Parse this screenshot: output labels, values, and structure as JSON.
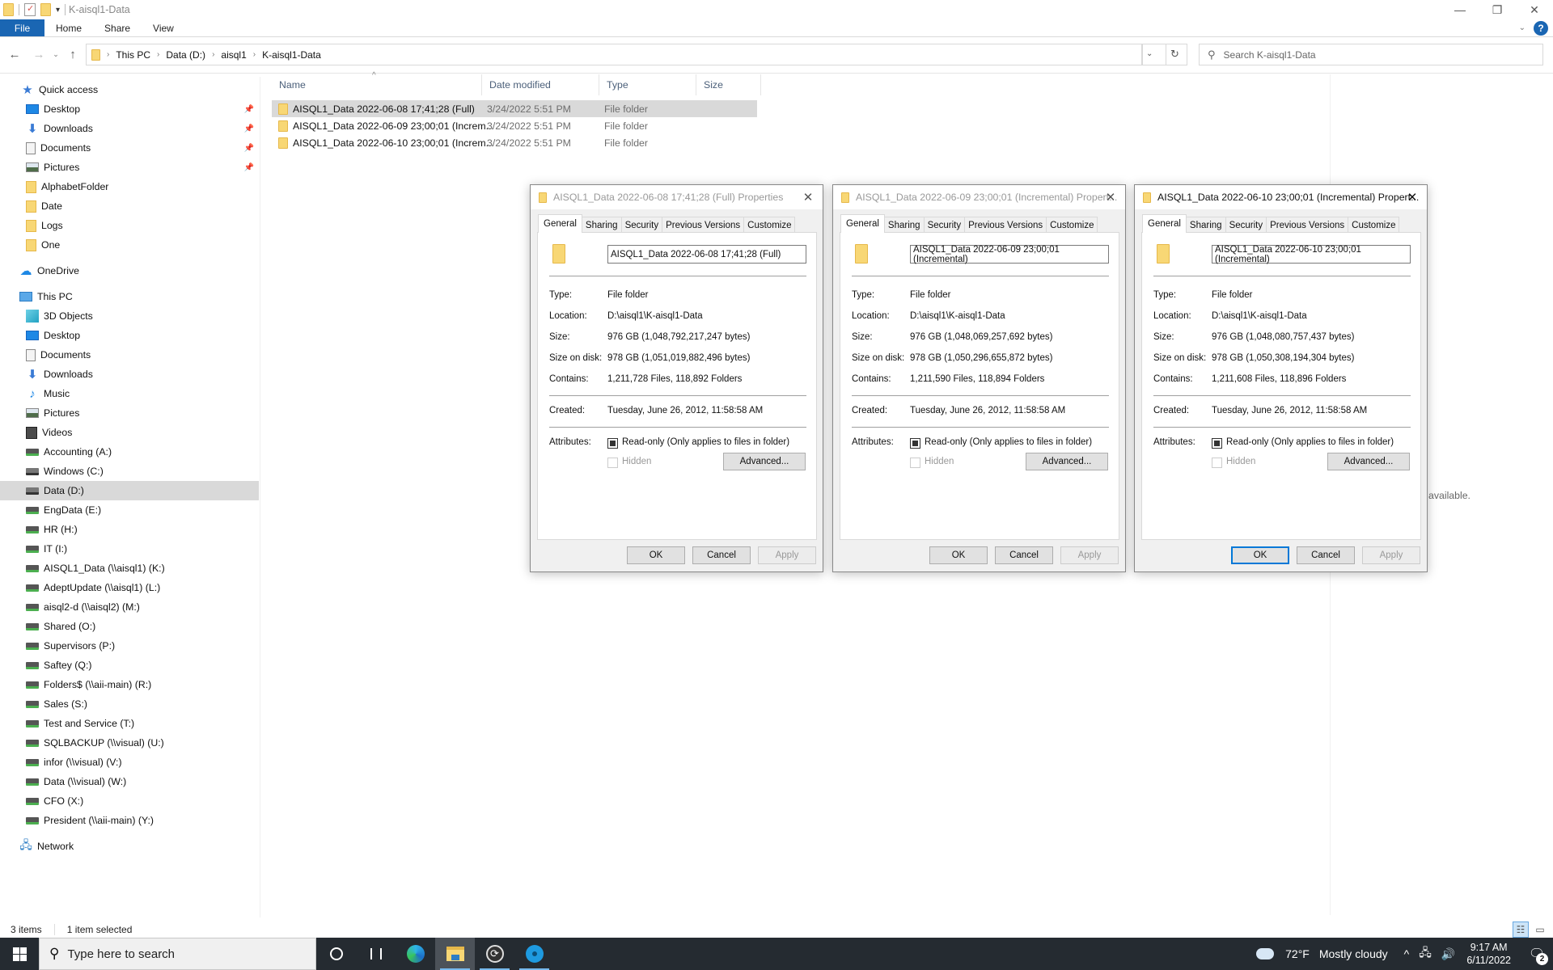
{
  "window": {
    "title": "K-aisql1-Data",
    "controls": {
      "minimize": "—",
      "maximize": "❐",
      "close": "✕"
    }
  },
  "ribbon": {
    "tabs": [
      "File",
      "Home",
      "Share",
      "View"
    ],
    "expand_icon": "chevron-down",
    "help_label": "?"
  },
  "nav": {
    "back": "←",
    "forward": "→",
    "recent": "⌄",
    "up": "↑",
    "breadcrumb": [
      "This PC",
      "Data (D:)",
      "aisql1",
      "K-aisql1-Data"
    ],
    "refresh": "↻",
    "search_placeholder": "Search K-aisql1-Data"
  },
  "sidebar": {
    "quick_access": {
      "label": "Quick access",
      "items": [
        {
          "label": "Desktop",
          "icon": "desktop",
          "pinned": true
        },
        {
          "label": "Downloads",
          "icon": "downloads",
          "pinned": true
        },
        {
          "label": "Documents",
          "icon": "documents",
          "pinned": true
        },
        {
          "label": "Pictures",
          "icon": "pictures",
          "pinned": true
        },
        {
          "label": "AlphabetFolder",
          "icon": "folder",
          "pinned": false
        },
        {
          "label": "Date",
          "icon": "folder",
          "pinned": false
        },
        {
          "label": "Logs",
          "icon": "folder",
          "pinned": false
        },
        {
          "label": "One",
          "icon": "folder",
          "pinned": false
        }
      ]
    },
    "onedrive": {
      "label": "OneDrive"
    },
    "this_pc": {
      "label": "This PC",
      "items": [
        {
          "label": "3D Objects",
          "icon": "3d"
        },
        {
          "label": "Desktop",
          "icon": "desktop"
        },
        {
          "label": "Documents",
          "icon": "documents"
        },
        {
          "label": "Downloads",
          "icon": "downloads"
        },
        {
          "label": "Music",
          "icon": "music"
        },
        {
          "label": "Pictures",
          "icon": "pictures"
        },
        {
          "label": "Videos",
          "icon": "videos"
        },
        {
          "label": "Accounting (A:)",
          "icon": "network-drive"
        },
        {
          "label": "Windows (C:)",
          "icon": "windows-drive"
        },
        {
          "label": "Data (D:)",
          "icon": "local-drive",
          "selected": true
        },
        {
          "label": "EngData (E:)",
          "icon": "network-drive"
        },
        {
          "label": "HR (H:)",
          "icon": "network-drive"
        },
        {
          "label": "IT (I:)",
          "icon": "network-drive"
        },
        {
          "label": "AISQL1_Data (\\\\aisql1) (K:)",
          "icon": "network-drive"
        },
        {
          "label": "AdeptUpdate (\\\\aisql1) (L:)",
          "icon": "network-drive"
        },
        {
          "label": "aisql2-d (\\\\aisql2) (M:)",
          "icon": "network-drive"
        },
        {
          "label": "Shared (O:)",
          "icon": "network-drive"
        },
        {
          "label": "Supervisors (P:)",
          "icon": "network-drive"
        },
        {
          "label": "Saftey (Q:)",
          "icon": "network-drive"
        },
        {
          "label": "Folders$ (\\\\aii-main) (R:)",
          "icon": "network-drive"
        },
        {
          "label": "Sales (S:)",
          "icon": "network-drive"
        },
        {
          "label": "Test and Service (T:)",
          "icon": "network-drive"
        },
        {
          "label": "SQLBACKUP (\\\\visual) (U:)",
          "icon": "network-drive"
        },
        {
          "label": "infor (\\\\visual) (V:)",
          "icon": "network-drive"
        },
        {
          "label": "Data (\\\\visual) (W:)",
          "icon": "network-drive"
        },
        {
          "label": "CFO (X:)",
          "icon": "network-drive"
        },
        {
          "label": "President (\\\\aii-main) (Y:)",
          "icon": "network-drive"
        }
      ]
    },
    "network": {
      "label": "Network"
    }
  },
  "filelist": {
    "columns": [
      "Name",
      "Date modified",
      "Type",
      "Size"
    ],
    "rows": [
      {
        "name": "AISQL1_Data 2022-06-08 17;41;28 (Full)",
        "date": "3/24/2022 5:51 PM",
        "type": "File folder",
        "size": "",
        "selected": true
      },
      {
        "name": "AISQL1_Data 2022-06-09 23;00;01 (Increm...",
        "date": "3/24/2022 5:51 PM",
        "type": "File folder",
        "size": "",
        "selected": false
      },
      {
        "name": "AISQL1_Data 2022-06-10 23;00;01 (Increm...",
        "date": "3/24/2022 5:51 PM",
        "type": "File folder",
        "size": "",
        "selected": false
      }
    ]
  },
  "preview": {
    "message": "view available."
  },
  "status": {
    "items": "3 items",
    "selected": "1 item selected"
  },
  "dialog_common": {
    "tabs": [
      "General",
      "Sharing",
      "Security",
      "Previous Versions",
      "Customize"
    ],
    "labels": {
      "type": "Type:",
      "location": "Location:",
      "size": "Size:",
      "size_on_disk": "Size on disk:",
      "contains": "Contains:",
      "created": "Created:",
      "attributes": "Attributes:"
    },
    "readonly_label": "Read-only (Only applies to files in folder)",
    "hidden_label": "Hidden",
    "advanced_label": "Advanced...",
    "ok_label": "OK",
    "cancel_label": "Cancel",
    "apply_label": "Apply",
    "close_icon": "✕"
  },
  "dialogs": [
    {
      "title": "AISQL1_Data 2022-06-08 17;41;28 (Full) Properties",
      "name": "AISQL1_Data 2022-06-08 17;41;28 (Full)",
      "type": "File folder",
      "location": "D:\\aisql1\\K-aisql1-Data",
      "size": "976 GB (1,048,792,217,247 bytes)",
      "size_on_disk": "978 GB (1,051,019,882,496 bytes)",
      "contains": "1,211,728 Files, 118,892 Folders",
      "created": "Tuesday, June 26, 2012, 11:58:58 AM",
      "readonly": "indeterminate",
      "hidden": false,
      "active": false
    },
    {
      "title": "AISQL1_Data 2022-06-09 23;00;01 (Incremental) Propert...",
      "name": "AISQL1_Data 2022-06-09 23;00;01 (Incremental)",
      "type": "File folder",
      "location": "D:\\aisql1\\K-aisql1-Data",
      "size": "976 GB (1,048,069,257,692 bytes)",
      "size_on_disk": "978 GB (1,050,296,655,872 bytes)",
      "contains": "1,211,590 Files, 118,894 Folders",
      "created": "Tuesday, June 26, 2012, 11:58:58 AM",
      "readonly": "indeterminate",
      "hidden": false,
      "active": false
    },
    {
      "title": "AISQL1_Data 2022-06-10 23;00;01 (Incremental) Propert...",
      "name": "AISQL1_Data 2022-06-10 23;00;01 (Incremental)",
      "type": "File folder",
      "location": "D:\\aisql1\\K-aisql1-Data",
      "size": "976 GB (1,048,080,757,437 bytes)",
      "size_on_disk": "978 GB (1,050,308,194,304 bytes)",
      "contains": "1,211,608 Files, 118,896 Folders",
      "created": "Tuesday, June 26, 2012, 11:58:58 AM",
      "readonly": "indeterminate",
      "hidden": false,
      "active": true
    }
  ],
  "taskbar": {
    "search_placeholder": "Type here to search",
    "apps": [
      "cortana",
      "task-view",
      "edge",
      "file-explorer",
      "sync-app",
      "disc-app"
    ],
    "weather": {
      "temp": "72°F",
      "condition": "Mostly cloudy"
    },
    "tray": {
      "chevron": "^",
      "network": "🖧",
      "volume": "🔊"
    },
    "clock": {
      "time": "9:17 AM",
      "date": "6/11/2022"
    },
    "notifications": {
      "count": "2"
    }
  }
}
